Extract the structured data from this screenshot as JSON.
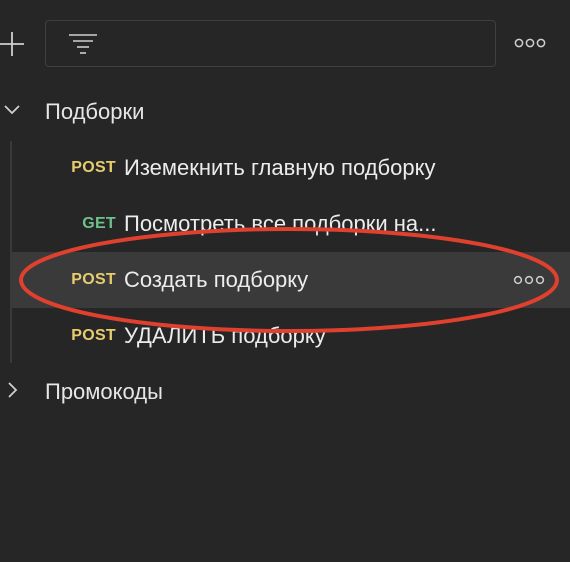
{
  "toolbar": {
    "add_icon": "plus-icon",
    "filter_icon": "filter-icon",
    "search_value": "",
    "more_icon": "more-horizontal-icon"
  },
  "tree": {
    "folders": [
      {
        "label": "Подборки",
        "expanded": true,
        "requests": [
          {
            "method": "POST",
            "label": "Иземекнить главную подборку"
          },
          {
            "method": "GET",
            "label": "Посмотреть все подборки на..."
          },
          {
            "method": "POST",
            "label": "Создать подборку",
            "selected": true
          },
          {
            "method": "POST",
            "label": "УДАЛИТЬ подборку"
          }
        ]
      },
      {
        "label": "Промокоды",
        "expanded": false
      }
    ]
  },
  "colors": {
    "background": "#262626",
    "method_post": "#e8cd6f",
    "method_get": "#6fc18a",
    "selected_row": "#3a3a3a",
    "annotation": "#e0402e"
  }
}
